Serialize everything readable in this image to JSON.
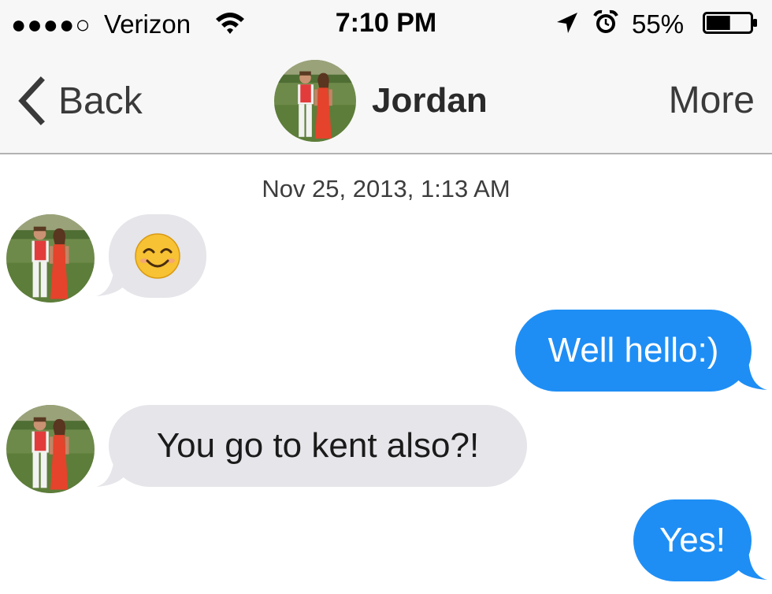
{
  "status_bar": {
    "signal": "●●●●○",
    "carrier": "Verizon",
    "time": "7:10 PM",
    "battery_percent": "55%",
    "battery_level": 0.55,
    "icons": [
      "wifi-icon",
      "location-arrow-icon",
      "alarm-clock-icon",
      "battery-icon"
    ]
  },
  "nav": {
    "back_label": "Back",
    "contact_name": "Jordan",
    "more_label": "More"
  },
  "conversation": {
    "timestamp": "Nov 25, 2013, 1:13 AM",
    "messages": [
      {
        "direction": "incoming",
        "text": "😊"
      },
      {
        "direction": "outgoing",
        "text": "Well hello:)"
      },
      {
        "direction": "incoming",
        "text": "You go to kent also?!"
      },
      {
        "direction": "outgoing",
        "text": "Yes!"
      }
    ]
  },
  "colors": {
    "outgoing_bubble": "#1e8ef5",
    "incoming_bubble": "#e5e5ea",
    "bar_background": "#f7f7f7"
  }
}
